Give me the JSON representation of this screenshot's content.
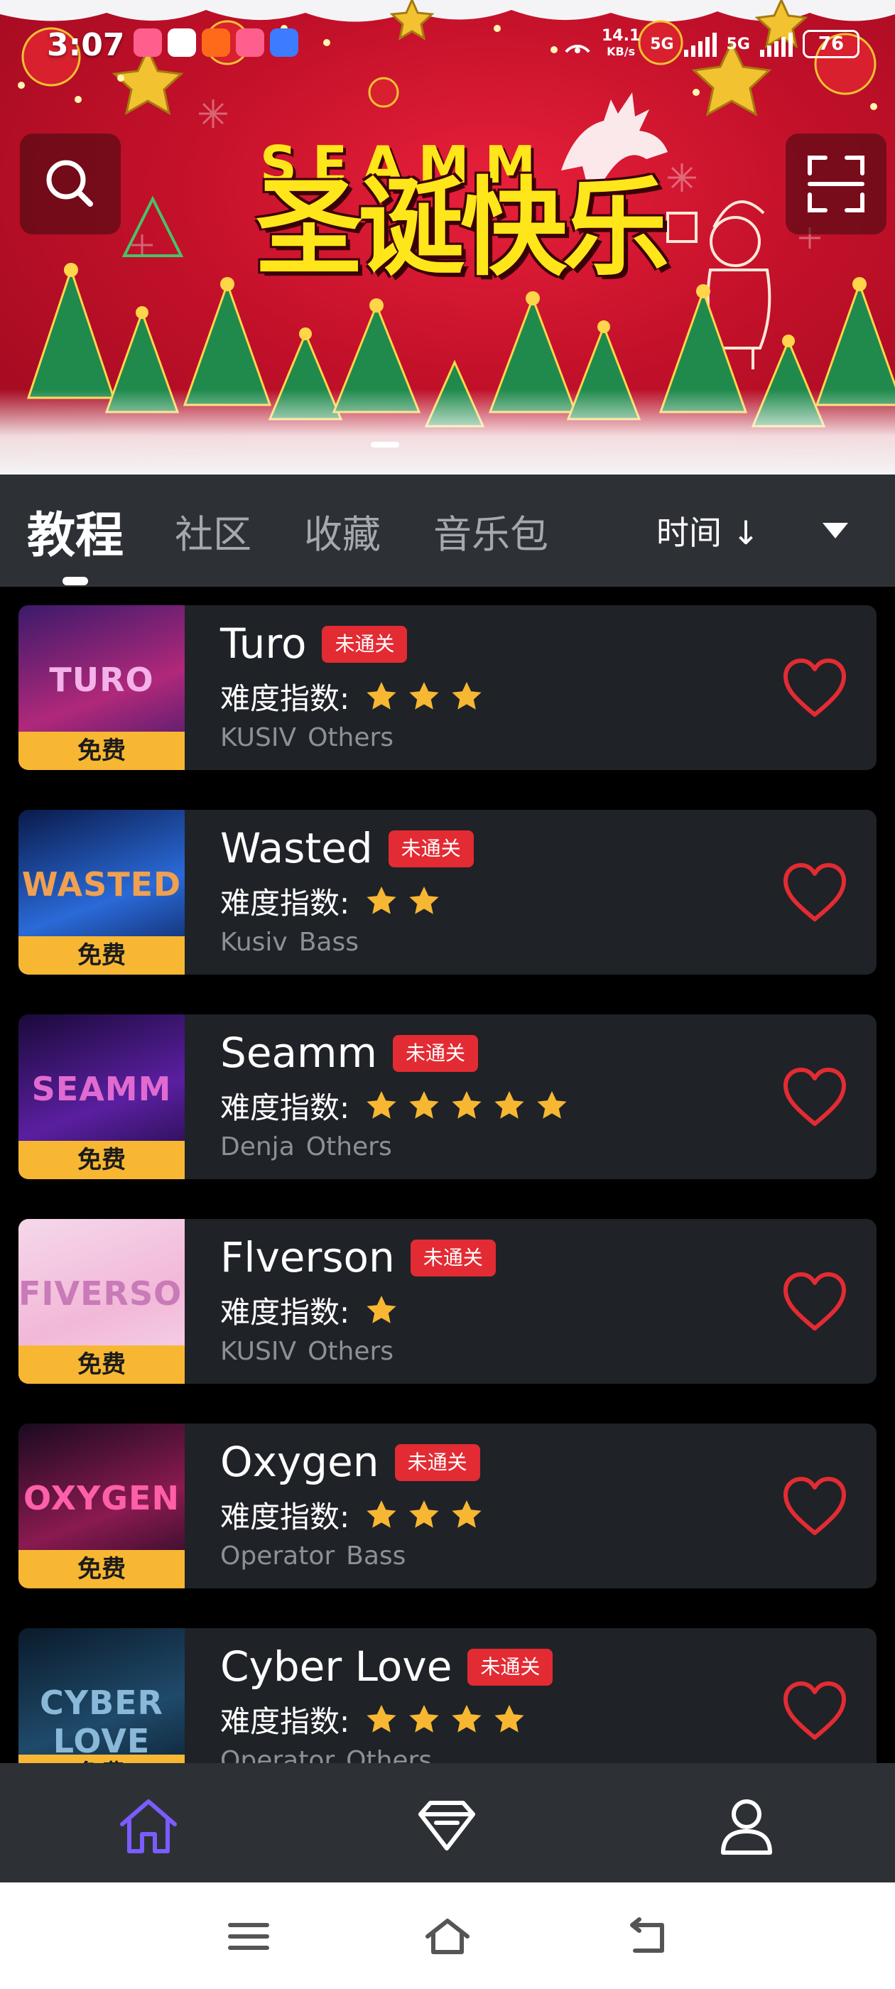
{
  "status_bar": {
    "time": "3:07",
    "speed_value": "14.1",
    "speed_unit": "KB/s",
    "network_1": "5G",
    "network_2": "5G",
    "battery": "76"
  },
  "banner": {
    "subtitle": "SEAMM",
    "title": "圣诞快乐"
  },
  "tabs": [
    {
      "label": "教程",
      "active": true
    },
    {
      "label": "社区",
      "active": false
    },
    {
      "label": "收藏",
      "active": false
    },
    {
      "label": "音乐包",
      "active": false
    }
  ],
  "sort": {
    "label": "时间 ↓"
  },
  "songs": [
    {
      "thumb_text": "TURO",
      "badge": "免费",
      "name": "Turo",
      "status": "未通关",
      "difficulty_label": "难度指数:",
      "stars": 3,
      "artist": "KUSIV",
      "genre": "Others",
      "colors": [
        "#3b1a6b",
        "#b0287a",
        "#f3b2e8"
      ]
    },
    {
      "thumb_text": "WASTED",
      "badge": "免费",
      "name": "Wasted",
      "status": "未通关",
      "difficulty_label": "难度指数:",
      "stars": 2,
      "artist": "Kusiv",
      "genre": "Bass",
      "colors": [
        "#0a1a4a",
        "#2a6ad8",
        "#f0a050"
      ]
    },
    {
      "thumb_text": "SEAMM",
      "badge": "免费",
      "name": "Seamm",
      "status": "未通关",
      "difficulty_label": "难度指数:",
      "stars": 5,
      "artist": "Denja",
      "genre": "Others",
      "colors": [
        "#1a0a3a",
        "#5a1fa0",
        "#e06ad0"
      ]
    },
    {
      "thumb_text": "FIVERSON",
      "badge": "免费",
      "name": "Flverson",
      "status": "未通关",
      "difficulty_label": "难度指数:",
      "stars": 1,
      "artist": "KUSIV",
      "genre": "Others",
      "colors": [
        "#f5d8ea",
        "#f2b8d8",
        "#c97ab8"
      ]
    },
    {
      "thumb_text": "OXYGEN",
      "badge": "免费",
      "name": "Oxygen",
      "status": "未通关",
      "difficulty_label": "难度指数:",
      "stars": 3,
      "artist": "Operator",
      "genre": "Bass",
      "colors": [
        "#1a0a20",
        "#8a1a50",
        "#ff5fa8"
      ]
    },
    {
      "thumb_text": "CYBER LOVE",
      "badge": "免费",
      "name": "Cyber Love",
      "status": "未通关",
      "difficulty_label": "难度指数:",
      "stars": 4,
      "artist": "Operator",
      "genre": "Others",
      "colors": [
        "#0a1a2a",
        "#1f4a6a",
        "#8ab8d8"
      ]
    }
  ],
  "bottom_nav": [
    {
      "icon": "home-icon",
      "active": true
    },
    {
      "icon": "diamond-icon",
      "active": false
    },
    {
      "icon": "profile-icon",
      "active": false
    }
  ],
  "colors": {
    "accent": "#7b5cff",
    "star": "#f7b733",
    "heart": "#e32b33",
    "tag": "#e32b33",
    "card_bg": "#1f2227",
    "bar_bg": "#2d3136"
  }
}
